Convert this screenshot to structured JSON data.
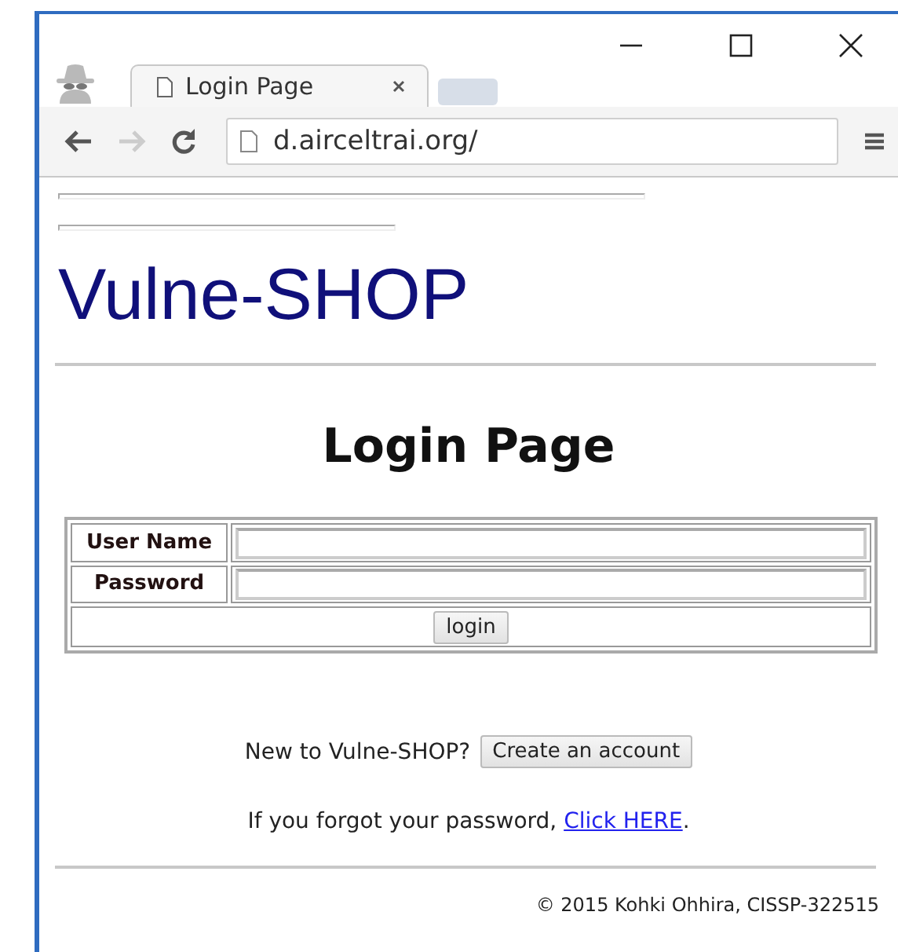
{
  "browser": {
    "tabs": [
      {
        "title": "Login Page",
        "selected": true
      }
    ],
    "address": "d.airceltrai.org/"
  },
  "page": {
    "logo": "Vulne-SHOP",
    "heading": "Login Page",
    "form": {
      "rows": [
        {
          "label": "User Name"
        },
        {
          "label": "Password"
        }
      ],
      "submit": "login"
    },
    "signup": {
      "text": "New to Vulne-SHOP?",
      "button": "Create an account"
    },
    "forgot": {
      "text": "If you forgot your password, ",
      "link": "Click HERE",
      "after": "."
    },
    "footer": "© 2015 Kohki Ohhira, CISSP-322515"
  }
}
